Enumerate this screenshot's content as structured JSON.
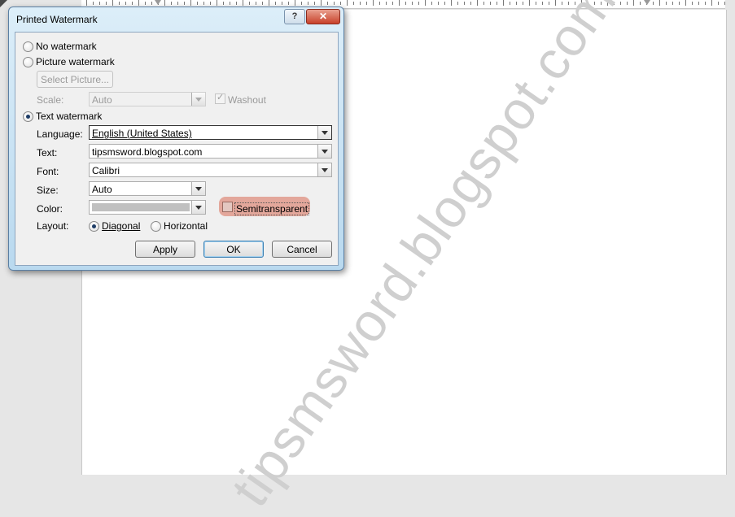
{
  "document": {
    "watermark_text": "tipsmsword.blogspot.com"
  },
  "dialog": {
    "title": "Printed Watermark",
    "help_label": "?",
    "close_label": "✕",
    "options": {
      "no_watermark": "No watermark",
      "picture_watermark": "Picture watermark",
      "text_watermark": "Text watermark",
      "selected": "text_watermark"
    },
    "picture": {
      "select_button": "Select Picture...",
      "scale_label": "Scale:",
      "scale_value": "Auto",
      "washout_label": "Washout",
      "washout_checked": true
    },
    "text": {
      "language_label": "Language:",
      "language_value": "English (United States)",
      "text_label": "Text:",
      "text_value": "tipsmsword.blogspot.com",
      "font_label": "Font:",
      "font_value": "Calibri",
      "size_label": "Size:",
      "size_value": "Auto",
      "color_label": "Color:",
      "color_value": "#c0c0c0",
      "semitransparent_label": "Semitransparent",
      "semitransparent_checked": false,
      "layout_label": "Layout:",
      "layout_diagonal": "Diagonal",
      "layout_horizontal": "Horizontal",
      "layout_selected": "diagonal"
    },
    "buttons": {
      "apply": "Apply",
      "ok": "OK",
      "cancel": "Cancel"
    }
  }
}
